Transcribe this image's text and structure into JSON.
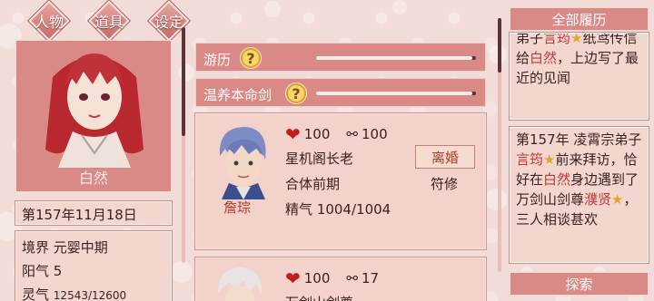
{
  "top_nav": {
    "tabs": [
      {
        "label": "人物"
      },
      {
        "label": "道具"
      },
      {
        "label": "设定"
      }
    ]
  },
  "character": {
    "name": "白然",
    "date": "第157年11月18日",
    "realm_label": "境界",
    "realm_value": "元婴中期",
    "yang_label": "阳气",
    "yang_value": "5",
    "ling_label": "灵气",
    "ling_value": "12543/12600"
  },
  "activities": [
    {
      "label": "游历",
      "help": "?",
      "progress": 0.98
    },
    {
      "label": "温养本命剑",
      "help": "?",
      "progress": 0.98
    }
  ],
  "partners": [
    {
      "name": "詹琮",
      "affection": "100",
      "bond": "100",
      "title": "星机阁长老",
      "realm": "合体前期",
      "jing_label": "精气",
      "jing_value": "1004/1004",
      "divorce_label": "离婚",
      "role": "符修"
    },
    {
      "affection": "100",
      "bond": "17",
      "title": "万剑山剑尊"
    }
  ],
  "log": {
    "title": "全部履历",
    "entries": [
      {
        "parts": [
          {
            "t": "弟子"
          },
          {
            "t": "言筠",
            "c": "hl"
          },
          {
            "t": "★",
            "c": "star"
          },
          {
            "t": "纸鸢传信给"
          },
          {
            "t": "白然",
            "c": "hl"
          },
          {
            "t": "，上边写了最近的见闻"
          }
        ]
      },
      {
        "parts": [
          {
            "t": "第157年 凌霄宗弟子"
          },
          {
            "t": "言筠",
            "c": "hl"
          },
          {
            "t": "★",
            "c": "star"
          },
          {
            "t": "前来拜访，恰好在"
          },
          {
            "t": "白然",
            "c": "hl"
          },
          {
            "t": "身边遇到了万剑山剑尊"
          },
          {
            "t": "濮贤",
            "c": "hl"
          },
          {
            "t": "★",
            "c": "star"
          },
          {
            "t": "，三人相谈甚欢"
          }
        ]
      }
    ],
    "search_label": "探索"
  },
  "colors": {
    "panel": "#d98a86",
    "panel_light": "#f3d7cf",
    "highlight": "#c03838",
    "star": "#e2a72a",
    "heart": "#c21b1b"
  }
}
